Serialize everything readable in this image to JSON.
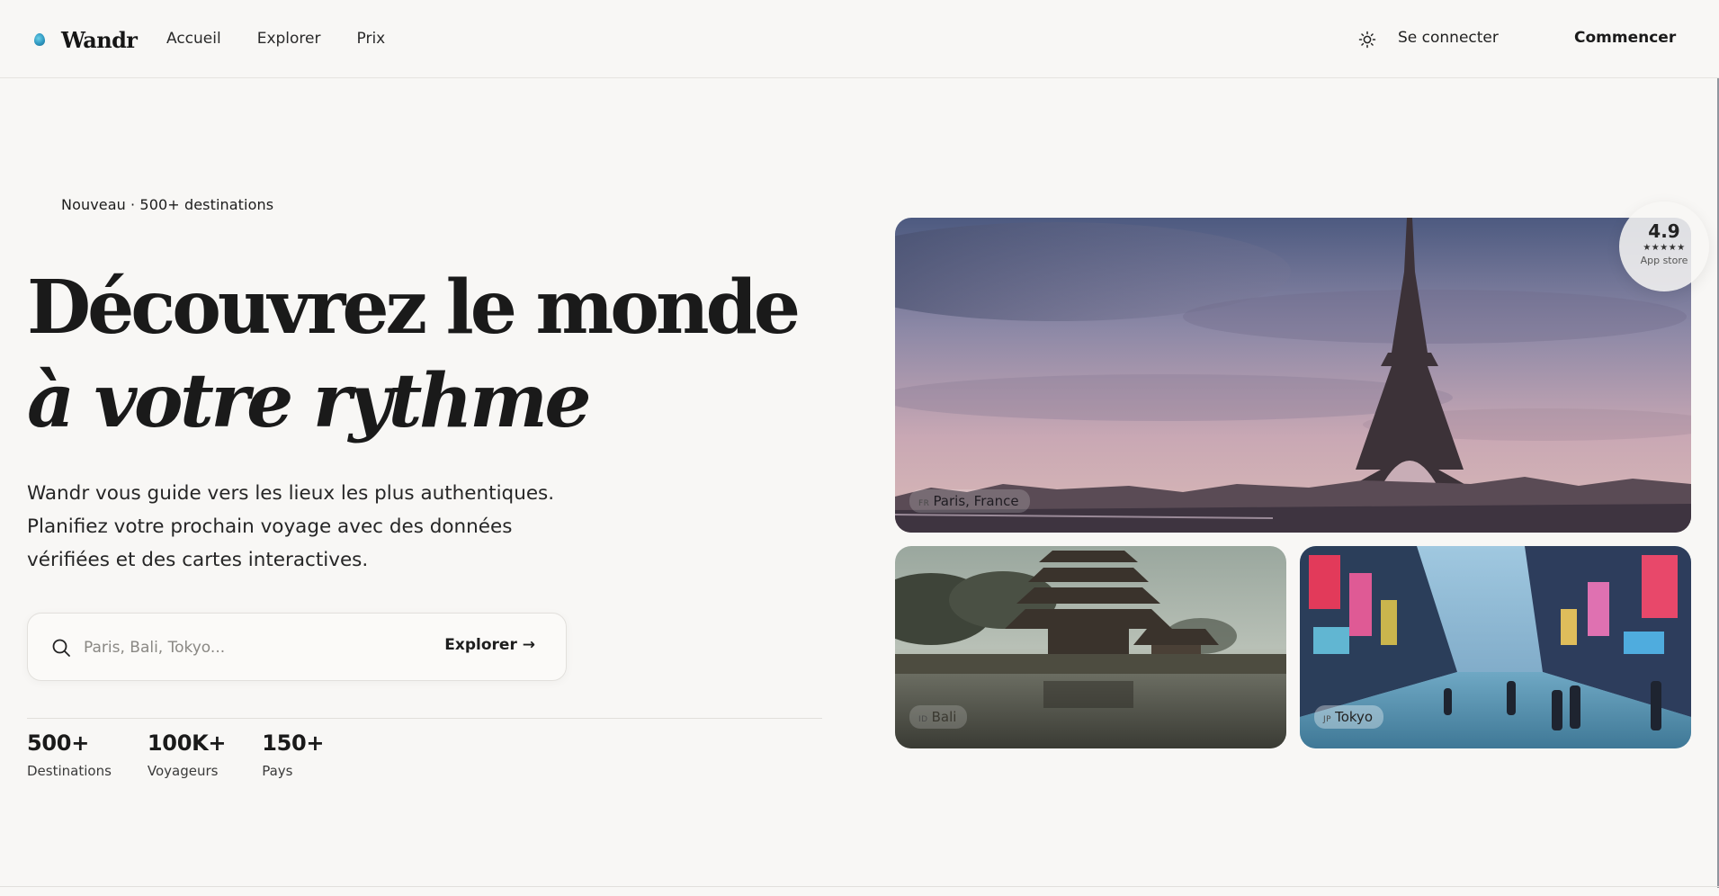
{
  "header": {
    "brand": "Wandr",
    "nav": [
      "Accueil",
      "Explorer",
      "Prix"
    ],
    "login_label": "Se connecter",
    "cta_label": "Commencer",
    "theme_icon": "sun-icon"
  },
  "hero": {
    "eyebrow": "Nouveau · 500+ destinations",
    "title_line1": "Découvrez le monde",
    "title_line2": "à votre rythme",
    "subtitle_lines": [
      "Wandr vous guide vers les lieux les plus authentiques.",
      "Planifiez votre prochain voyage avec des données",
      "vérifiées et des cartes interactives."
    ],
    "search": {
      "placeholder": "Paris, Bali, Tokyo...",
      "button_label": "Explorer →",
      "icon": "search-icon"
    },
    "stats": [
      {
        "value": "500+",
        "label": "Destinations"
      },
      {
        "value": "100K+",
        "label": "Voyageurs"
      },
      {
        "value": "150+",
        "label": "Pays"
      }
    ]
  },
  "destinations": [
    {
      "code": "FR",
      "name": "Paris, France"
    },
    {
      "code": "ID",
      "name": "Bali"
    },
    {
      "code": "JP",
      "name": "Tokyo"
    }
  ],
  "rating": {
    "value": "4.9",
    "stars": "★★★★★",
    "label": "App store"
  },
  "colors": {
    "background": "#f8f7f5",
    "text": "#1a1a1a",
    "border": "#e2e0dc",
    "logo_accent": "#2f98c1"
  }
}
